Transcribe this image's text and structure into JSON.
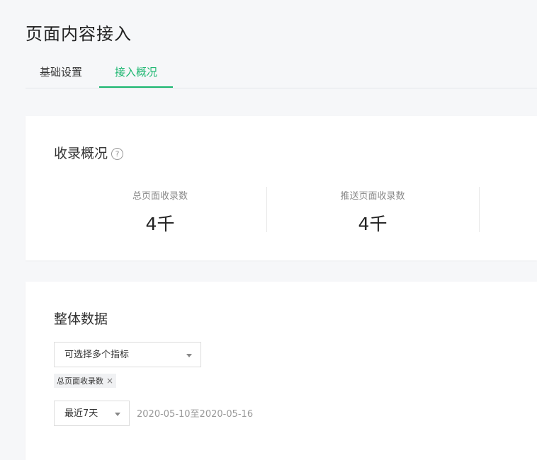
{
  "page": {
    "title": "页面内容接入"
  },
  "tabs": [
    {
      "label": "基础设置",
      "active": false
    },
    {
      "label": "接入概况",
      "active": true
    }
  ],
  "overview": {
    "title": "收录概况",
    "help_icon": "question-circle-icon",
    "stats": [
      {
        "label": "总页面收录数",
        "value": "4千"
      },
      {
        "label": "推送页面收录数",
        "value": "4千"
      }
    ]
  },
  "overall": {
    "title": "整体数据",
    "metric_select": {
      "placeholder": "可选择多个指标"
    },
    "selected_tags": [
      {
        "label": "总页面收录数",
        "close": "×"
      }
    ],
    "range_select": {
      "value": "最近7天"
    },
    "date_range": "2020-05-10至2020-05-16"
  },
  "colors": {
    "accent": "#1ab66f",
    "background": "#f6f7f9"
  }
}
